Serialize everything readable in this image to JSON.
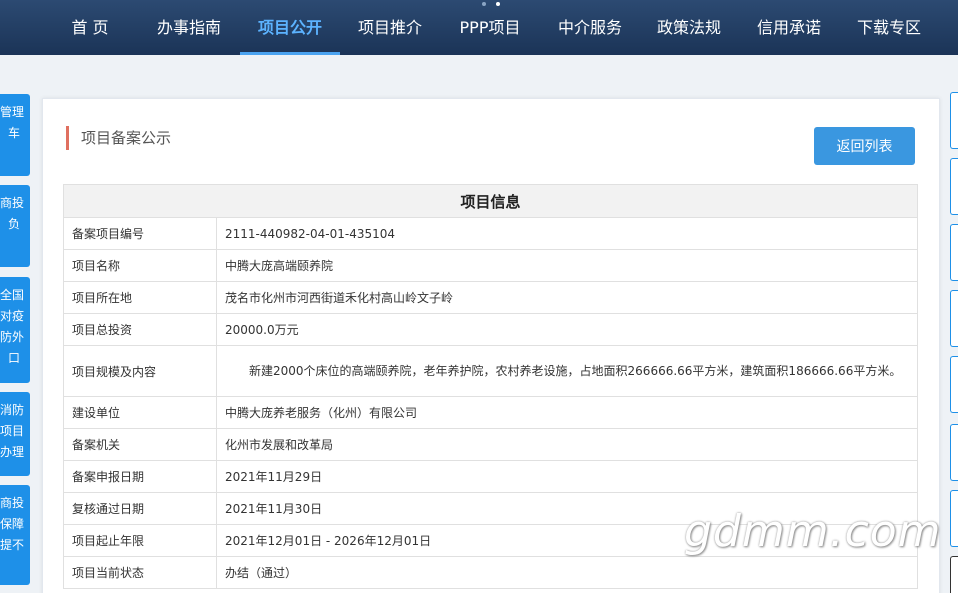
{
  "nav": {
    "items": [
      {
        "label": "首 页",
        "active": false
      },
      {
        "label": "办事指南",
        "active": false
      },
      {
        "label": "项目公开",
        "active": true
      },
      {
        "label": "项目推介",
        "active": false
      },
      {
        "label": "PPP项目",
        "active": false
      },
      {
        "label": "中介服务",
        "active": false
      },
      {
        "label": "政策法规",
        "active": false
      },
      {
        "label": "信用承诺",
        "active": false
      },
      {
        "label": "下载专区",
        "active": false
      }
    ]
  },
  "left_tabs": [
    {
      "lines": [
        "管理",
        "车"
      ]
    },
    {
      "lines": [
        "商投",
        "负"
      ]
    },
    {
      "lines": [
        "全国",
        "对疫",
        "防外",
        "口"
      ]
    },
    {
      "lines": [
        "消防",
        "项目",
        "办理"
      ]
    },
    {
      "lines": [
        "商投",
        "保障",
        "提不"
      ]
    }
  ],
  "panel": {
    "title": "项目备案公示",
    "back_button": "返回列表"
  },
  "table": {
    "header": "项目信息",
    "rows": [
      {
        "label": "备案项目编号",
        "value": "2111-440982-04-01-435104"
      },
      {
        "label": "项目名称",
        "value": "中腾大庞高端颐养院"
      },
      {
        "label": "项目所在地",
        "value": "茂名市化州市河西街道禾化村高山岭文子岭"
      },
      {
        "label": "项目总投资",
        "value": "20000.0万元"
      },
      {
        "label": "项目规模及内容",
        "value": "新建2000个床位的高端颐养院，老年养护院，农村养老设施，占地面积266666.66平方米，建筑面积186666.66平方米。"
      },
      {
        "label": "建设单位",
        "value": "中腾大庞养老服务（化州）有限公司"
      },
      {
        "label": "备案机关",
        "value": "化州市发展和改革局"
      },
      {
        "label": "备案申报日期",
        "value": "2021年11月29日"
      },
      {
        "label": "复核通过日期",
        "value": "2021年11月30日"
      },
      {
        "label": "项目起止年限",
        "value": "2021年12月01日 - 2026年12月01日"
      },
      {
        "label": "项目当前状态",
        "value": "办结（通过）"
      }
    ]
  },
  "watermark": "gdmm.com"
}
